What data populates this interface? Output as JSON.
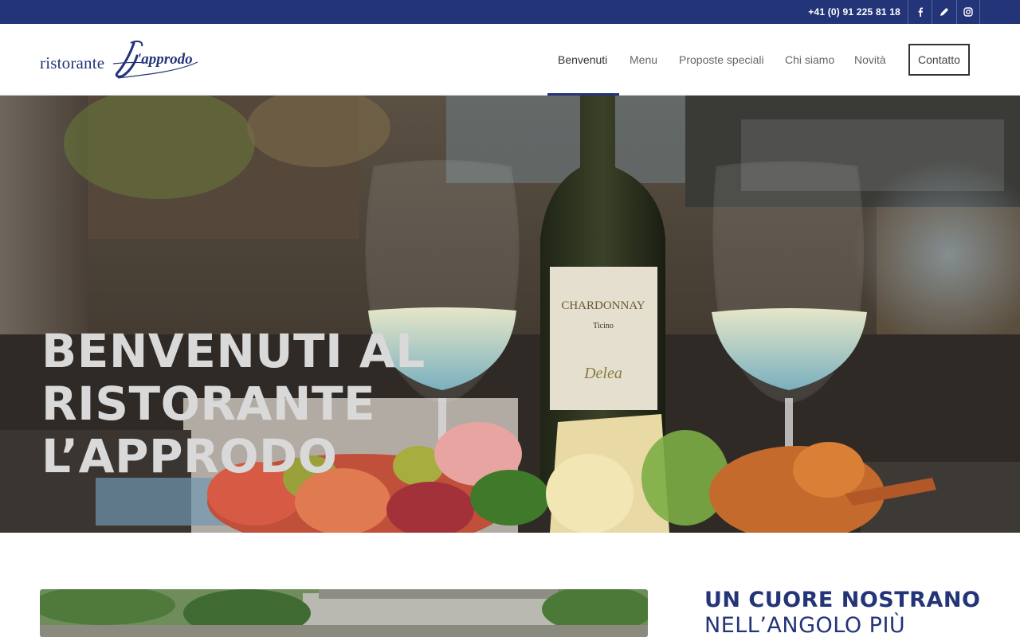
{
  "topbar": {
    "phone": "+41 (0) 91 225 81 18",
    "bg_color": "#233478",
    "social": [
      {
        "name": "facebook",
        "icon": "facebook-icon"
      },
      {
        "name": "pen",
        "icon": "pen-icon"
      },
      {
        "name": "instagram",
        "icon": "instagram-icon"
      }
    ]
  },
  "logo": {
    "word": "ristorante",
    "script": "l'approdo"
  },
  "nav": {
    "items": [
      {
        "label": "Benvenuti",
        "active": true
      },
      {
        "label": "Menu",
        "active": false
      },
      {
        "label": "Proposte speciali",
        "active": false
      },
      {
        "label": "Chi siamo",
        "active": false
      },
      {
        "label": "Novità",
        "active": false
      }
    ],
    "contact_label": "Contatto",
    "accent_color": "#233478"
  },
  "hero": {
    "title_lines": [
      "BENVENUTI AL",
      "RISTORANTE",
      "L’APPRODO"
    ],
    "image_subject": "wine-bottle-glasses-antipasto-plate"
  },
  "intro": {
    "heading_bold": "UN CUORE NOSTRANO",
    "heading_light": "NELL’ANGOLO PIÙ"
  }
}
